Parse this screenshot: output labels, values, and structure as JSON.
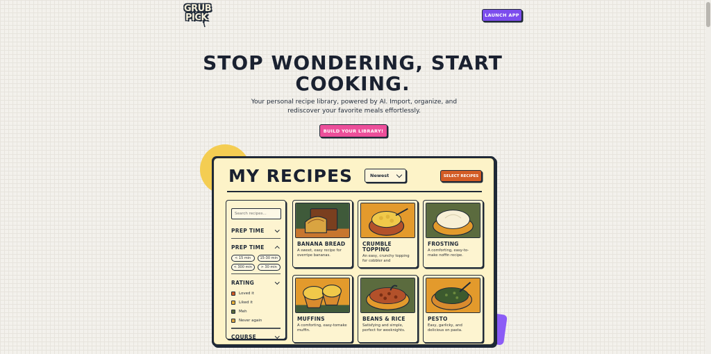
{
  "header": {
    "logo_line1": "GRUB",
    "logo_line2": "PICK",
    "launch_label": "LAUNCH APP"
  },
  "hero": {
    "title_line1": "STOP WONDERING, START",
    "title_line2": "COOKING.",
    "subtitle_line1": "Your personal recipe library, powered by AI. Import, organize, and",
    "subtitle_line2": "rediscover your favorite meals effortlessly.",
    "cta_label": "BUILD YOUR LIBRARY!"
  },
  "app": {
    "title": "MY RECIPES",
    "sort_value": "Newest",
    "select_label": "SELECT RECIPES",
    "sidebar": {
      "search_placeholder": "Search recipes...",
      "filters": [
        {
          "label": "PREP TIME",
          "expanded": false
        },
        {
          "label": "PREP TIME",
          "expanded": true
        },
        {
          "label": "RATING",
          "expanded": true
        },
        {
          "label": "COURSE",
          "expanded": false
        }
      ],
      "prep_chips": [
        "< 15 min",
        "15-30 min",
        "< 300 min",
        "> 30 min"
      ],
      "ratings": [
        {
          "label": "Loved it",
          "color": "#d35c25"
        },
        {
          "label": "Liked it",
          "color": "#e8b23a"
        },
        {
          "label": "Meh",
          "color": "#5c6b3b"
        },
        {
          "label": "Never again",
          "color": "#d9a441"
        }
      ]
    },
    "cards": [
      {
        "title": "BANANA BREAD",
        "desc": "A sweet, easy recipe for overripe bananas.",
        "icon": "banana-bread-image"
      },
      {
        "title": "CRUMBLE TOPPING",
        "desc": "An easy, crunchy topping for cobbler and",
        "icon": "crumble-topping-image"
      },
      {
        "title": "FROSTING",
        "desc": "A comforting, easy-to-make noffin recipe.",
        "icon": "frosting-image"
      },
      {
        "title": "MUFFINS",
        "desc": "A comforting, easy-tomake muffin.",
        "icon": "muffins-image"
      },
      {
        "title": "BEANS & RICE",
        "desc": "Satisfying and simple, perfect for weeknights.",
        "icon": "beans-rice-image"
      },
      {
        "title": "PESTO",
        "desc": "Easy, garlicky, and delicious on pasta.",
        "icon": "pesto-image"
      }
    ]
  }
}
